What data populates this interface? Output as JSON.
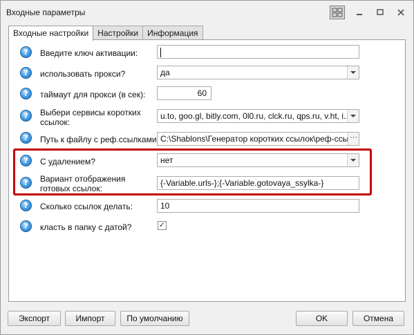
{
  "window": {
    "title": "Входные параметры"
  },
  "titlebar_icons": [
    "layout-icon",
    "minimize-icon",
    "maximize-icon",
    "close-icon"
  ],
  "tabs": [
    {
      "label": "Входные настройки",
      "active": true
    },
    {
      "label": "Настройки",
      "active": false
    },
    {
      "label": "Информация",
      "active": false
    }
  ],
  "fields": {
    "activation_key": {
      "label": "Введите ключ активации:",
      "value": ""
    },
    "use_proxy": {
      "label": "использовать прокси?",
      "value": "да"
    },
    "proxy_timeout": {
      "label": "таймаут для прокси (в сек):",
      "value": "60"
    },
    "short_services": {
      "label": "Выбери сервисы коротких ссылок:",
      "value": "u.to, goo.gl, bitly.com, 0l0.ru, clck.ru, qps.ru, v.ht, i..."
    },
    "ref_file_path": {
      "label": "Путь к файлу с реф.ссылками:",
      "value": "C:\\Shablons\\Генератор коротких ссылок\\реф-ссылки"
    },
    "with_delete": {
      "label": "С удалением?",
      "value": "нет"
    },
    "display_variant": {
      "label": "Вариант отображения готовых ссылок:",
      "value": "{-Variable.urls-};{-Variable.gotovaya_ssylka-}"
    },
    "links_count": {
      "label": "Сколько ссылок делать:",
      "value": "10"
    },
    "date_folder": {
      "label": "класть в  папку с датой?",
      "checked": true
    }
  },
  "help_glyph": "?",
  "buttons": {
    "export": "Экспорт",
    "import": "Импорт",
    "defaults": "По умолчанию",
    "ok": "OK",
    "cancel": "Отмена"
  },
  "colors": {
    "highlight": "#c40000",
    "help_icon": "#2a7fd0"
  }
}
